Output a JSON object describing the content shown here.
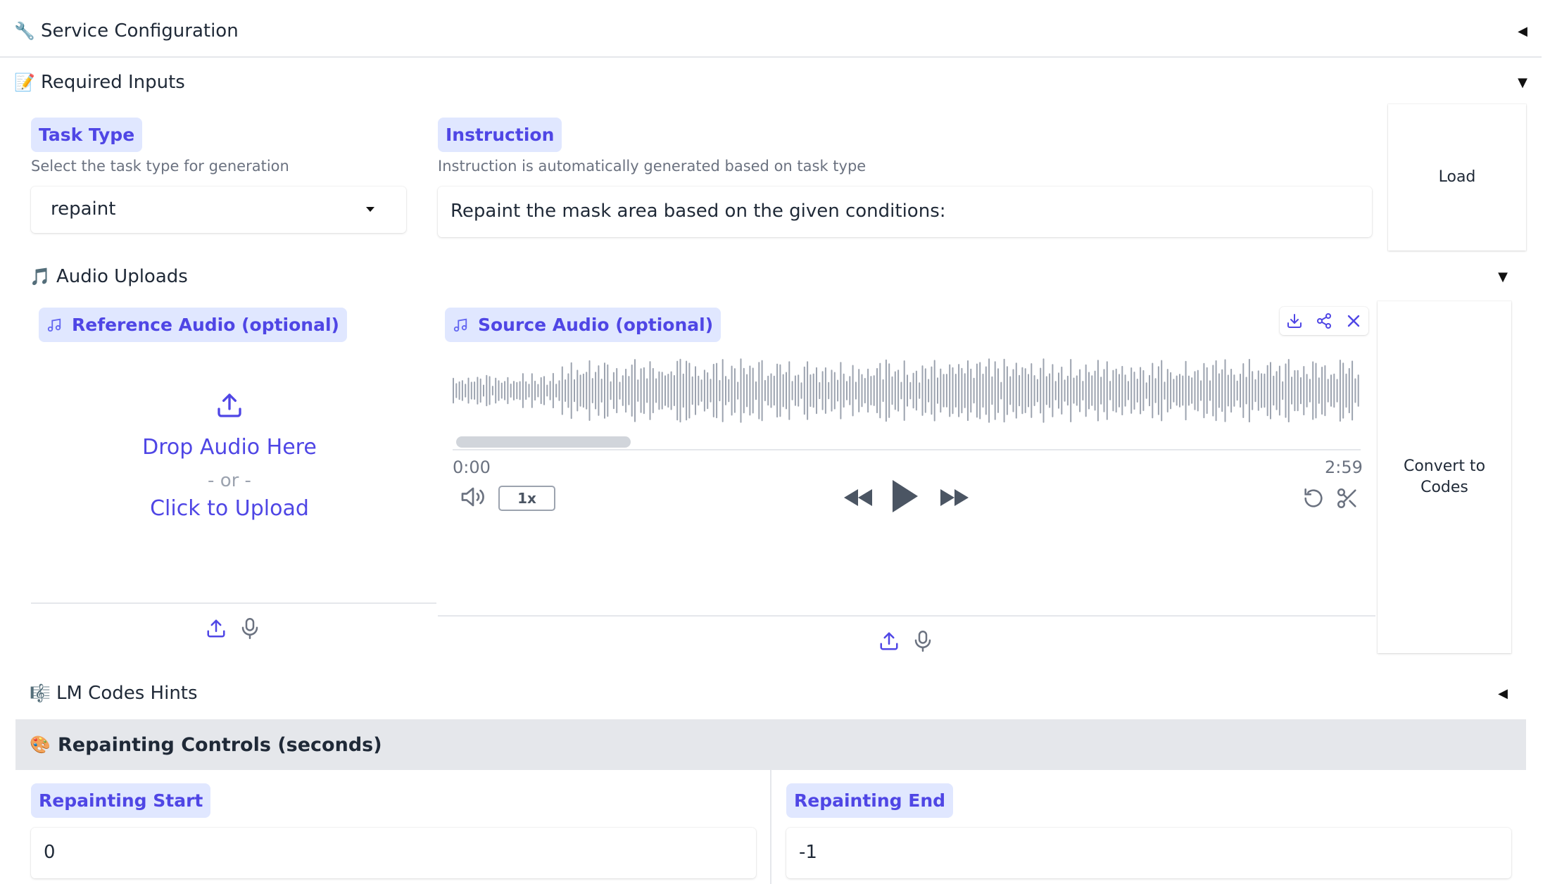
{
  "service_config": {
    "emoji": "🔧",
    "label": "Service Configuration",
    "arrow": "◀"
  },
  "required_inputs": {
    "emoji": "📝",
    "label": "Required Inputs",
    "arrow": "▼"
  },
  "task_type": {
    "label": "Task Type",
    "hint": "Select the task type for generation",
    "value": "repaint"
  },
  "instruction": {
    "label": "Instruction",
    "hint": "Instruction is automatically generated based on task type",
    "value": "Repaint the mask area based on the given conditions:"
  },
  "load_button": {
    "label": "Load"
  },
  "audio_uploads": {
    "emoji": "🎵",
    "label": "Audio Uploads",
    "arrow": "▼"
  },
  "reference_audio": {
    "label": "Reference Audio (optional)",
    "drop_text": "Drop Audio Here",
    "or_text": "- or -",
    "click_text": "Click to Upload"
  },
  "source_audio": {
    "label": "Source Audio (optional)",
    "time_start": "0:00",
    "time_end": "2:59",
    "speed": "1x",
    "progress": 0.0
  },
  "convert_button": {
    "label_line1": "Convert to",
    "label_line2": "Codes"
  },
  "lm_codes": {
    "emoji": "🎼",
    "label": "LM Codes Hints",
    "arrow": "◀"
  },
  "repainting_controls": {
    "emoji": "🎨",
    "label": "Repainting Controls (seconds)"
  },
  "repainting_start": {
    "label": "Repainting Start",
    "value": "0"
  },
  "repainting_end": {
    "label": "Repainting End",
    "value": "-1"
  },
  "colors": {
    "accent": "#4f46e5",
    "chip_bg": "#e0e7ff",
    "waveform": "#9ca3af"
  }
}
